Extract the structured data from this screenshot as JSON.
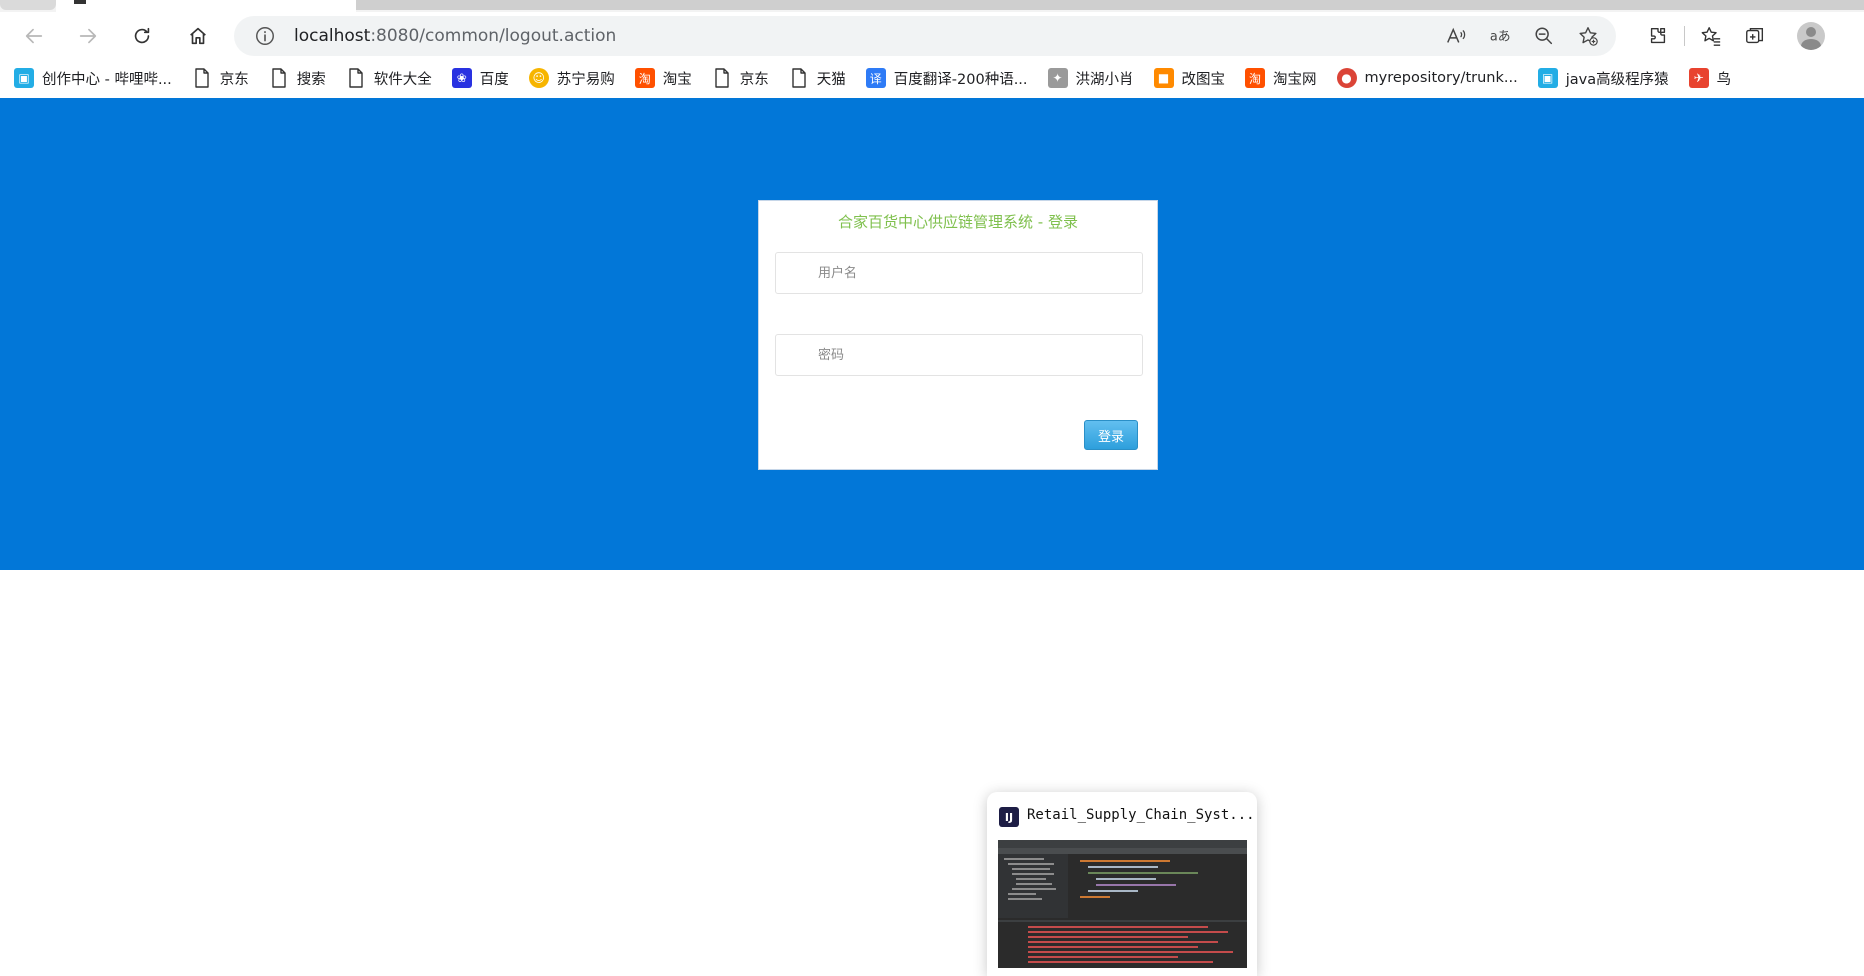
{
  "browser": {
    "url_host": "localhost",
    "url_rest": ":8080/common/logout.action"
  },
  "bookmarks": [
    {
      "label": "创作中心 - 哔哩哔...",
      "icon": "bilibili-icon"
    },
    {
      "label": "京东",
      "icon": "page-icon"
    },
    {
      "label": "搜索",
      "icon": "page-icon"
    },
    {
      "label": "软件大全",
      "icon": "page-icon"
    },
    {
      "label": "百度",
      "icon": "baidu-icon"
    },
    {
      "label": "苏宁易购",
      "icon": "suning-icon"
    },
    {
      "label": "淘宝",
      "icon": "taobao-icon"
    },
    {
      "label": "京东",
      "icon": "page-icon"
    },
    {
      "label": "天猫",
      "icon": "page-icon"
    },
    {
      "label": "百度翻译-200种语...",
      "icon": "baidu-translate-icon"
    },
    {
      "label": "洪湖小肖",
      "icon": "bird-icon"
    },
    {
      "label": "改图宝",
      "icon": "gaitubao-icon"
    },
    {
      "label": "淘宝网",
      "icon": "taobao-icon"
    },
    {
      "label": "myrepository/trunk...",
      "icon": "chrome-icon"
    },
    {
      "label": "java高级程序猿",
      "icon": "bilibili-icon"
    },
    {
      "label": "鸟",
      "icon": "bird-red-icon"
    }
  ],
  "login": {
    "title": "合家百货中心供应链管理系统 - 登录",
    "username_placeholder": "用户名",
    "password_placeholder": "密码",
    "submit_label": "登录"
  },
  "preview": {
    "icon_text": "IJ",
    "title": "Retail_Supply_Chain_Syst..."
  },
  "colors": {
    "page_background": "#0277d8",
    "title_green": "#7fc04d",
    "button_blue": "#2d9fdc"
  }
}
